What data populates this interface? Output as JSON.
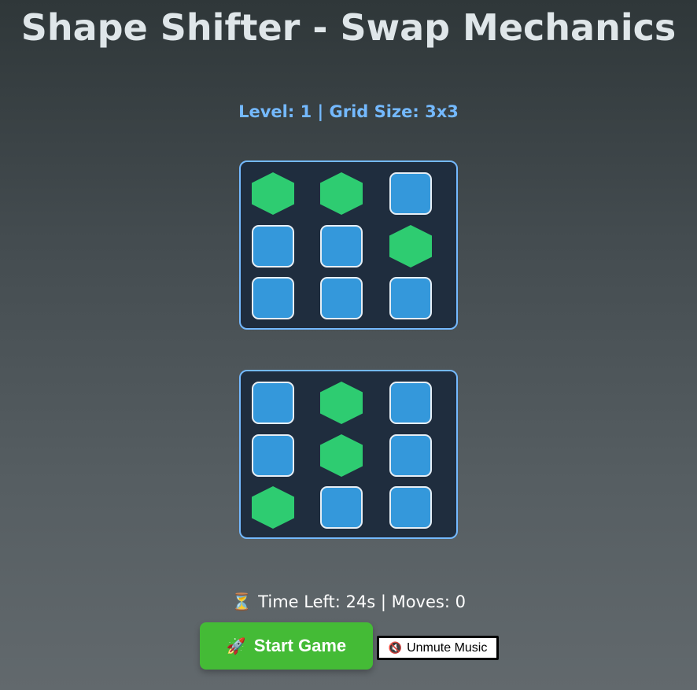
{
  "title": "Shape Shifter - Swap Mechanics",
  "level_info": "Level: 1 | Grid Size: 3x3",
  "colors": {
    "square": "#3498db",
    "hexagon": "#2ecc71",
    "accent": "#74b9ff",
    "start_button": "#44bb36"
  },
  "target_grid": [
    [
      "hexagon",
      "hexagon",
      "square"
    ],
    [
      "square",
      "square",
      "hexagon"
    ],
    [
      "square",
      "square",
      "square"
    ]
  ],
  "player_grid": [
    [
      "square",
      "hexagon",
      "square"
    ],
    [
      "square",
      "hexagon",
      "square"
    ],
    [
      "hexagon",
      "square",
      "square"
    ]
  ],
  "status": {
    "icon": "hourglass-icon",
    "text": "Time Left: 24s | Moves: 0"
  },
  "start_button": {
    "icon": "rocket-icon",
    "label": "Start Game"
  },
  "music_button": {
    "icon": "muted-speaker-icon",
    "label": "Unmute Music"
  }
}
